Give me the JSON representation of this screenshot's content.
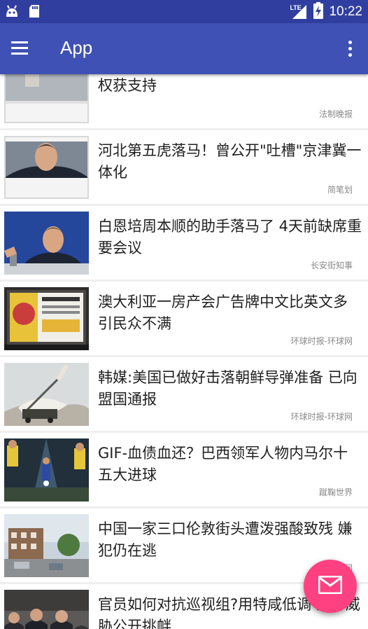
{
  "status_bar": {
    "time": "10:22",
    "network": "LTE",
    "icons": [
      "android-icon",
      "sd-card-icon",
      "lte-signal-icon",
      "battery-charging-icon"
    ]
  },
  "app_bar": {
    "title": "App",
    "icons": [
      "menu-icon",
      "more-vert-icon"
    ]
  },
  "colors": {
    "primary": "#3f51b5",
    "primary_dark": "#303f9f",
    "accent": "#ff4081"
  },
  "news": [
    {
      "title": "吴京独孙慕威中文九号京婴京服话真监护权获支持",
      "source": "法制晚报"
    },
    {
      "title": "河北第五虎落马！曾公开\"吐槽\"京津冀一体化",
      "source": "简笔划"
    },
    {
      "title": "白恩培周本顺的助手落马了 4天前缺席重要会议",
      "source": "长安街知事"
    },
    {
      "title": "澳大利亚一房产会广告牌中文比英文多 引民众不满",
      "source": "环球时报-环球网"
    },
    {
      "title": "韩媒:美国已做好击落朝鲜导弹准备 已向盟国通报",
      "source": "环球时报-环球网"
    },
    {
      "title": "GIF-血债血还？巴西领军人物内马尔十五大进球",
      "source": "蹴鞠世界"
    },
    {
      "title": "中国一家三口伦敦街头遭泼强酸致残 嫌犯仍在逃",
      "source": "海外网"
    },
    {
      "title": "官员如何对抗巡视组?用特咸低调 置身威胁公开挑衅",
      "source": ""
    }
  ],
  "fab": {
    "icon": "email-icon"
  }
}
